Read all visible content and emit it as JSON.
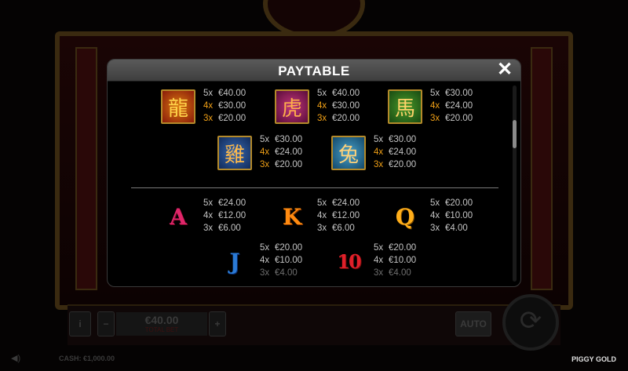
{
  "game": {
    "name": "PIGGY GOLD",
    "cash_text": "CASH: €1,000.00",
    "bet_amount": "€40.00",
    "bet_label": "TOTAL BET",
    "minus_label": "−",
    "plus_label": "+",
    "info_label": "i",
    "auto_label": "AUTO",
    "spin_icon": "refresh-arrows-icon"
  },
  "dialog": {
    "title": "PAYTABLE",
    "close_label": "✕"
  },
  "high_symbols": [
    {
      "symbol": "dragon",
      "glyph": "龍",
      "pays": [
        {
          "count": "5x",
          "amount": "€40.00"
        },
        {
          "count": "4x",
          "amount": "€30.00"
        },
        {
          "count": "3x",
          "amount": "€20.00"
        }
      ]
    },
    {
      "symbol": "tiger",
      "glyph": "虎",
      "pays": [
        {
          "count": "5x",
          "amount": "€40.00"
        },
        {
          "count": "4x",
          "amount": "€30.00"
        },
        {
          "count": "3x",
          "amount": "€20.00"
        }
      ]
    },
    {
      "symbol": "horse",
      "glyph": "馬",
      "pays": [
        {
          "count": "5x",
          "amount": "€30.00"
        },
        {
          "count": "4x",
          "amount": "€24.00"
        },
        {
          "count": "3x",
          "amount": "€20.00"
        }
      ]
    },
    {
      "symbol": "rooster",
      "glyph": "雞",
      "pays": [
        {
          "count": "5x",
          "amount": "€30.00"
        },
        {
          "count": "4x",
          "amount": "€24.00"
        },
        {
          "count": "3x",
          "amount": "€20.00"
        }
      ]
    },
    {
      "symbol": "rabbit",
      "glyph": "兔",
      "pays": [
        {
          "count": "5x",
          "amount": "€30.00"
        },
        {
          "count": "4x",
          "amount": "€24.00"
        },
        {
          "count": "3x",
          "amount": "€20.00"
        }
      ]
    }
  ],
  "low_symbols": [
    {
      "symbol": "A",
      "pays": [
        {
          "count": "5x",
          "amount": "€24.00"
        },
        {
          "count": "4x",
          "amount": "€12.00"
        },
        {
          "count": "3x",
          "amount": "€6.00"
        }
      ]
    },
    {
      "symbol": "K",
      "pays": [
        {
          "count": "5x",
          "amount": "€24.00"
        },
        {
          "count": "4x",
          "amount": "€12.00"
        },
        {
          "count": "3x",
          "amount": "€6.00"
        }
      ]
    },
    {
      "symbol": "Q",
      "pays": [
        {
          "count": "5x",
          "amount": "€20.00"
        },
        {
          "count": "4x",
          "amount": "€10.00"
        },
        {
          "count": "3x",
          "amount": "€4.00"
        }
      ]
    },
    {
      "symbol": "J",
      "pays": [
        {
          "count": "5x",
          "amount": "€20.00"
        },
        {
          "count": "4x",
          "amount": "€10.00"
        },
        {
          "count": "3x",
          "amount": "€4.00"
        }
      ]
    },
    {
      "symbol": "10",
      "pays": [
        {
          "count": "5x",
          "amount": "€20.00"
        },
        {
          "count": "4x",
          "amount": "€10.00"
        },
        {
          "count": "3x",
          "amount": "€4.00"
        }
      ]
    }
  ],
  "colors": {
    "high_count_5x": "#c4c4c4",
    "high_count_4x_3x": "#f0a016",
    "low_count": "#c4c4c4",
    "low_dim_3x": "#6e6e6e",
    "close_icon": "#ffffff"
  }
}
